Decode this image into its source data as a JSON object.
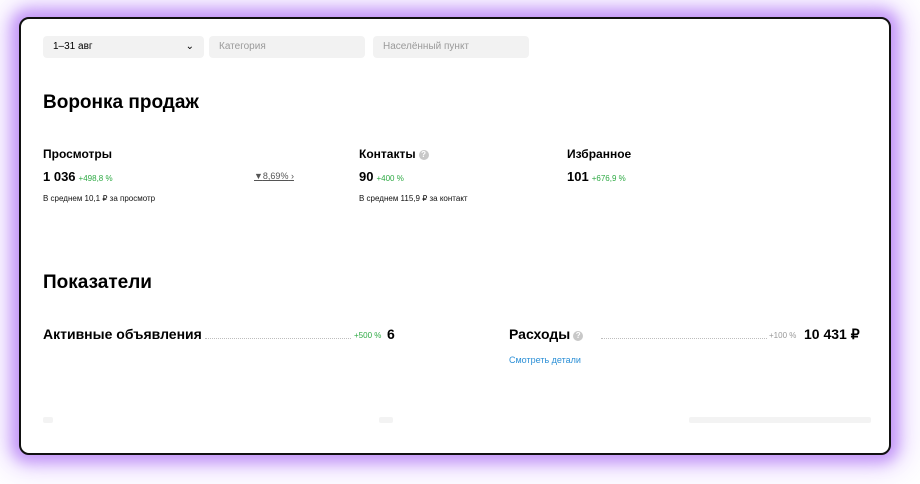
{
  "filters": {
    "period": "1–31 авг",
    "category_placeholder": "Категория",
    "location_placeholder": "Населённый пункт"
  },
  "funnel": {
    "title": "Воронка продаж",
    "views": {
      "label": "Просмотры",
      "value": "1 036",
      "delta": "+498,8 %",
      "sub": "В среднем 10,1 ₽ за просмотр"
    },
    "conversion": "8,69%",
    "contacts": {
      "label": "Контакты",
      "value": "90",
      "delta": "+400 %",
      "sub": "В среднем 115,9 ₽ за контакт"
    },
    "favorites": {
      "label": "Избранное",
      "value": "101",
      "delta": "+676,9 %"
    }
  },
  "indicators": {
    "title": "Показатели",
    "active_ads": {
      "label": "Активные объявления",
      "delta": "+500 %",
      "value": "6"
    },
    "expenses": {
      "label": "Расходы",
      "delta": "+100 %",
      "value": "10 431 ₽",
      "details_link": "Смотреть детали"
    }
  },
  "colors": {
    "positive": "#2eaa44",
    "link": "#2b8fd6",
    "frame_glow": "#a05af0"
  }
}
